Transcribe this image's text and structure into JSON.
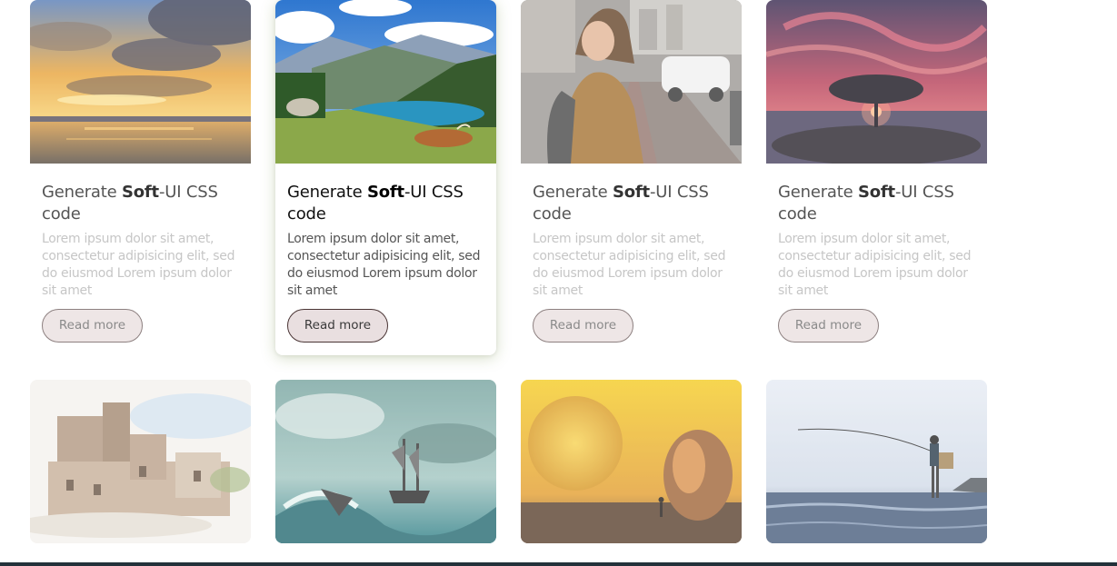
{
  "cards": [
    {
      "title_pre": "Generate ",
      "title_bold": "Soft",
      "title_post": "-UI CSS code",
      "text": "Lorem ipsum dolor sit amet, consectetur adipisicing elit, sed do eiusmod Lorem ipsum dolor sit amet",
      "button": "Read more",
      "image": "sunset-lake-clouds"
    },
    {
      "title_pre": "Generate ",
      "title_bold": "Soft",
      "title_post": "-UI CSS code",
      "text": "Lorem ipsum dolor sit amet, consectetur adipisicing elit, sed do eiusmod Lorem ipsum dolor sit amet",
      "button": "Read more",
      "image": "mountain-lake-highland-cow",
      "active": true
    },
    {
      "title_pre": "Generate ",
      "title_bold": "Soft",
      "title_post": "-UI CSS code",
      "text": "Lorem ipsum dolor sit amet, consectetur adipisicing elit, sed do eiusmod Lorem ipsum dolor sit amet",
      "button": "Read more",
      "image": "woman-city-street"
    },
    {
      "title_pre": "Generate ",
      "title_bold": "Soft",
      "title_post": "-UI CSS code",
      "text": "Lorem ipsum dolor sit amet, consectetur adipisicing elit, sed do eiusmod Lorem ipsum dolor sit amet",
      "button": "Read more",
      "image": "tree-red-sky"
    }
  ],
  "second_row_images": [
    "watercolor-village",
    "ship-stormy-sea",
    "golden-planet-rock",
    "fisherman-sea"
  ]
}
